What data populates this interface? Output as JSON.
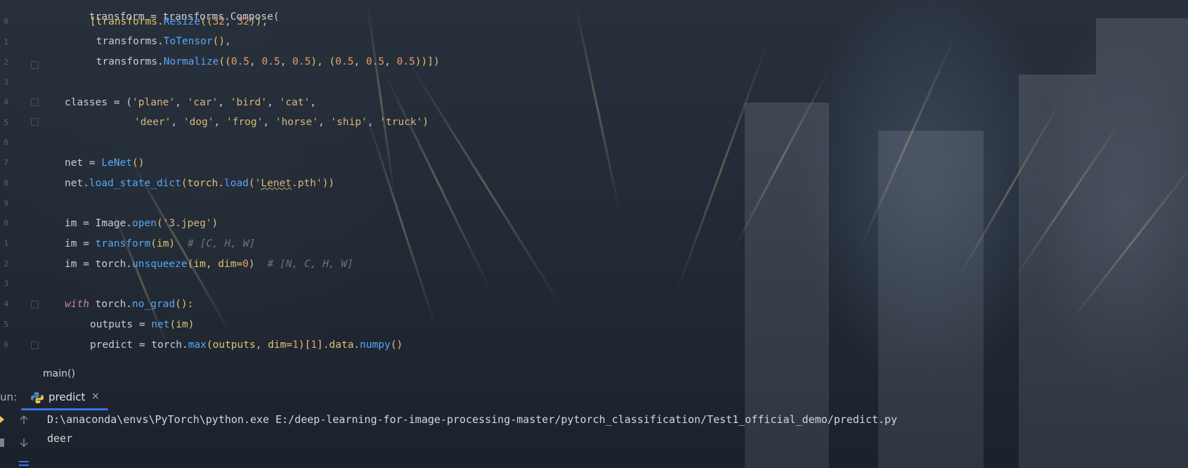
{
  "editor": {
    "gutter": [
      "0",
      "1",
      "2",
      "3",
      "4",
      "5",
      "6",
      "7",
      "8",
      "9",
      "0",
      "1",
      "2",
      "3",
      "4",
      "5",
      "6"
    ],
    "code": {
      "l0": "transform = transforms.Compose(",
      "l1a": "[transforms.",
      "l1b": "Resize",
      "l1c": "((",
      "l1d": "32",
      "l1e": ", ",
      "l1f": "32",
      "l1g": ")),",
      "l2a": " transforms.",
      "l2b": "ToTensor",
      "l2c": "(),",
      "l3a": " transforms.",
      "l3b": "Normalize",
      "l3c": "((",
      "l3d": "0.5",
      "l3e": ", ",
      "l3f": "0.5",
      "l3g": ", ",
      "l3h": "0.5",
      "l3i": "), (",
      "l3j": "0.5",
      "l3k": ", ",
      "l3l": "0.5",
      "l3m": ", ",
      "l3n": "0.5",
      "l3o": "))])",
      "l5a": "classes = (",
      "l5b": "'plane'",
      "l5c": ", ",
      "l5d": "'car'",
      "l5e": ", ",
      "l5f": "'bird'",
      "l5g": ", ",
      "l5h": "'cat'",
      "l5i": ",",
      "l6a": "'deer'",
      "l6b": ", ",
      "l6c": "'dog'",
      "l6d": ", ",
      "l6e": "'frog'",
      "l6f": ", ",
      "l6g": "'horse'",
      "l6h": ", ",
      "l6i": "'ship'",
      "l6j": ", ",
      "l6k": "'truck'",
      "l6l": ")",
      "l8a": "net = ",
      "l8b": "LeNet",
      "l8c": "()",
      "l9a": "net.",
      "l9b": "load_state_dict",
      "l9c": "(torch.",
      "l9d": "load",
      "l9e": "(",
      "l9f": "'",
      "l9g": "Lenet",
      "l9h": ".pth'",
      "l9i": "))",
      "l11a": "im = Image.",
      "l11b": "open",
      "l11c": "(",
      "l11d": "'3.jpeg'",
      "l11e": ")",
      "l12a": "im = ",
      "l12b": "transform",
      "l12c": "(im)",
      "l12d": "# [C, H, W]",
      "l13a": "im = torch.",
      "l13b": "unsqueeze",
      "l13c": "(im, dim=",
      "l13d": "0",
      "l13e": ")",
      "l13f": "# [N, C, H, W]",
      "l15a": "with",
      "l15b": " torch.",
      "l15c": "no_grad",
      "l15d": "():",
      "l16a": "outputs = ",
      "l16b": "net",
      "l16c": "(im)",
      "l17a": "predict = torch.",
      "l17b": "max",
      "l17c": "(outputs, dim=",
      "l17d": "1",
      "l17e": ")[",
      "l17f": "1",
      "l17g": "].data.",
      "l17h": "numpy",
      "l17i": "()"
    }
  },
  "breadcrumb": {
    "label": "main()"
  },
  "run": {
    "label": "un:",
    "tab_label": "predict",
    "close": "×"
  },
  "console": {
    "command": "D:\\anaconda\\envs\\PyTorch\\python.exe E:/deep-learning-for-image-processing-master/pytorch_classification/Test1_official_demo/predict.py",
    "output": "deer"
  },
  "colors": {
    "accent": "#3574f0",
    "keyword": "#c77dbb",
    "function": "#56a8f5",
    "string": "#6aab73",
    "number": "#e89b6a",
    "comment": "#6f737a"
  },
  "icons": {
    "python": "python-icon",
    "up": "arrow-up-icon",
    "down": "arrow-down-icon",
    "run": "run-icon",
    "stop": "stop-icon",
    "menu": "menu-icon"
  }
}
